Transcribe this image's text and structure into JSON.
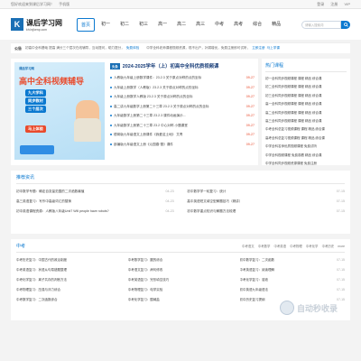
{
  "topbar": {
    "welcome": "您好欢迎来到课后学习网！",
    "mobile": "手机版",
    "login": "登录",
    "register": "注册",
    "vip": "VIP"
  },
  "logo": {
    "mark": "K",
    "cn": "课后学习网",
    "en": "kh.hrjkenp.com"
  },
  "nav": [
    "首页",
    "初一",
    "初二",
    "初三",
    "高一",
    "高二",
    "高三",
    "中考",
    "高考",
    "综合",
    "精品"
  ],
  "search": {
    "placeholder": "请输入搜索词"
  },
  "notice": {
    "label": "公告",
    "text": "初高中全科基础 提高 满分三个层次在线辅导，互动提问，助力提分，",
    "link1": "免费体验",
    "text2": "中学全科老师课程视频资源，现不出户，补弱增优，免费注册即可试听，",
    "link2": "立即注册",
    "link3": "马上学课"
  },
  "banner": {
    "brand": "课后学习网",
    "title": "高中全科视频辅导",
    "tags": [
      "九大学科",
      "同步教材",
      "三个层次"
    ],
    "cta": "马上体验"
  },
  "lessons": {
    "badge": "头条",
    "title": "2024-2025学年（上）初高中全科优质视频课",
    "items": [
      {
        "text": "人教版九年级上册数学课件：23.2.3 关于原点对称的点的坐标",
        "date": "09-27"
      },
      {
        "text": "九年级上册数学（人教版）23.2.3 关于原点对称的点的坐标",
        "date": "09-27"
      },
      {
        "text": "九年级上册数学人教版 23.2.3 关于原点对称的点的坐标",
        "date": "09-27"
      },
      {
        "text": "高二讲九年级数学上册第二十三章 23.2.3 关于原点对称的点的坐标",
        "date": "09-27"
      },
      {
        "text": "九年级数学上册第二十三章 23.2.3 课件动画演示...",
        "date": "09-27"
      },
      {
        "text": "九年级数学上册第二十三章 23.2 中心对称 小题课堂",
        "date": "09-27"
      },
      {
        "text": "德育版九年级语文上册课件《我爱这土地》 艾青",
        "date": "09-27"
      },
      {
        "text": "部编版九年级语文上册《沁园春·雪》课件",
        "date": "09-27"
      }
    ]
  },
  "hot": {
    "title": "热门课程",
    "items": [
      "初一全科同步视频课程 课程 精品 综合课",
      "初二全科同步视频课程 课程 精品 综合课",
      "初三全科同步视频课程 课程 精品 综合课",
      "高一全科同步视频课程 课程 精品 综合课",
      "高二全科同步视频课程 课程 精品 综合课",
      "高三全科同步视频课程 课程 精品 综合课",
      "中考全科总复习视频课程 课程 精品 综合课",
      "高考全科总复习视频课程 课程 精品 综合课",
      "中学全科名师优质视频课程 免费试听",
      "中学全科视频课程 免费观看 精品 综合课",
      "中学全科同步视频资源课程 免费注册"
    ]
  },
  "recommend": {
    "title": "推荐资讯",
    "left": [
      {
        "text": "初中数学专题：确定自变量范围的二次函数最值",
        "date": "04-23"
      },
      {
        "text": "高三英语复习：写作中高级词汇的替换",
        "date": "04-23"
      },
      {
        "text": "初中英语课程资源：人教版八年级Unit7 Will people have robots?",
        "date": "04-23"
      }
    ],
    "right": [
      {
        "text": "初中数学学一轮复习：统计",
        "date": "07-15"
      },
      {
        "text": "高中英语短文填空型解题技巧（精讲）",
        "date": "07-15"
      },
      {
        "text": "初中数学重点知识与解题方法梳理",
        "date": "07-15"
      }
    ]
  },
  "zhongkao": {
    "title": "中考",
    "tabs": [
      "中考语文",
      "中考数学",
      "中考英语",
      "中考物理",
      "中考化学",
      "中考历史",
      "more"
    ],
    "col1": [
      {
        "text": "中考历史复习：中国古代的政治制度",
        "date": ""
      },
      {
        "text": "中考英语复习：状语从句易错题整理",
        "date": ""
      },
      {
        "text": "中考化学复习：离子共存的判断方法",
        "date": ""
      },
      {
        "text": "中考物理复习：压强与浮力综合",
        "date": ""
      },
      {
        "text": "中考数学复习：二次函数综合",
        "date": ""
      }
    ],
    "col2": [
      {
        "text": "中考数学复习：圆的综合",
        "date": ""
      },
      {
        "text": "中考语文复习：病句修改",
        "date": ""
      },
      {
        "text": "中考英语复习：完形填空技巧",
        "date": ""
      },
      {
        "text": "中考物理复习：电学实验",
        "date": ""
      },
      {
        "text": "中考化学复习：酸碱盐",
        "date": ""
      }
    ],
    "col3": [
      {
        "text": "初中数学复习：二次函数",
        "date": "07-15"
      },
      {
        "text": "中考英语复习：阅读理解",
        "date": "07-15"
      },
      {
        "text": "中考化学复习：溶液",
        "date": "07-15"
      },
      {
        "text": "初中英语九年级语法",
        "date": "07-15"
      },
      {
        "text": "初中历史复习提纲",
        "date": "07-15"
      }
    ]
  },
  "watermark": {
    "t1": "自动秒收录",
    "t2": ""
  }
}
